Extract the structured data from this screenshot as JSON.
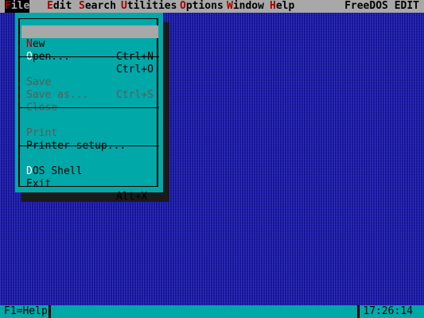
{
  "app_title": "FreeDOS EDIT",
  "menubar": {
    "items": [
      {
        "hot": "F",
        "rest": "ile"
      },
      {
        "hot": "E",
        "rest": "dit"
      },
      {
        "hot": "S",
        "rest": "earch"
      },
      {
        "hot": "U",
        "rest": "tilities"
      },
      {
        "hot": "O",
        "rest": "ptions"
      },
      {
        "hot": "W",
        "rest": "indow"
      },
      {
        "hot": "H",
        "rest": "elp"
      }
    ]
  },
  "file_menu": {
    "items": [
      {
        "hot": "N",
        "rest": "ew",
        "shortcut": "Ctrl+N",
        "enabled": true,
        "selected": true
      },
      {
        "hot": "O",
        "rest": "pen...",
        "shortcut": "Ctrl+O",
        "enabled": true
      },
      {
        "hot": "S",
        "rest": "ave",
        "shortcut": "Ctrl+S",
        "enabled": false
      },
      {
        "hot": "",
        "rest": "Save as...",
        "shortcut": "",
        "enabled": false
      },
      {
        "hot": "",
        "rest": "Close",
        "shortcut": "",
        "enabled": false
      },
      {
        "hot": "",
        "rest": "Print",
        "shortcut": "",
        "enabled": false
      },
      {
        "hot": "",
        "rest": "Printer setup...",
        "shortcut": "",
        "enabled": true
      },
      {
        "hot": "D",
        "rest": "OS Shell",
        "shortcut": "",
        "enabled": true
      },
      {
        "hot": "",
        "rest": "Exit",
        "shortcut": "Alt+X",
        "enabled": true
      }
    ]
  },
  "statusbar": {
    "help": "F1=Help",
    "time": "17:26:14"
  },
  "colors": {
    "desktop": "#1c1ca8",
    "menubar": "#a8a8a8",
    "menu": "#00a8a8",
    "hotkey": "#a80000",
    "disabled": "#5c5c5c"
  }
}
